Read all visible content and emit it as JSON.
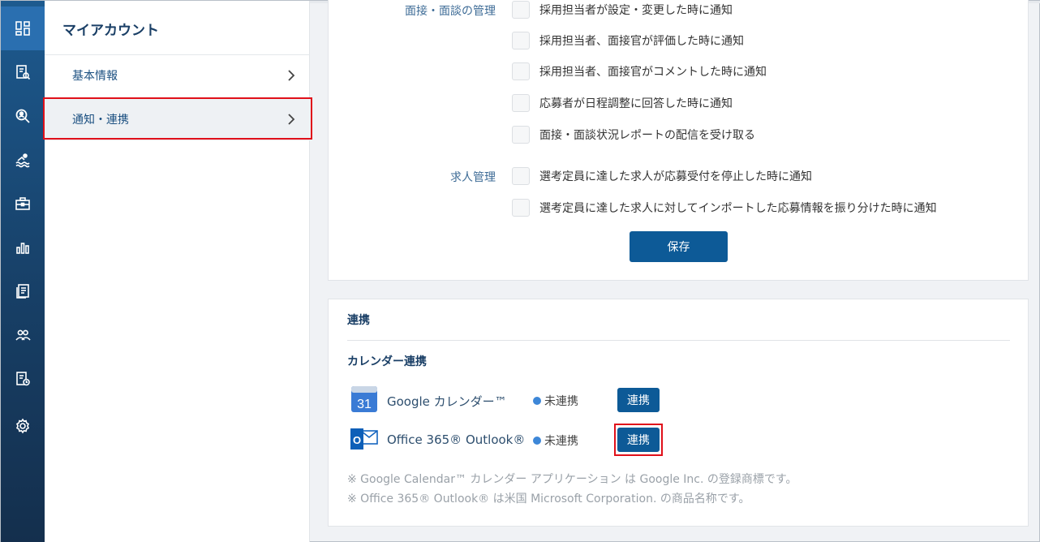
{
  "sidebar": {
    "title": "マイアカウント",
    "items": [
      {
        "label": "基本情報"
      },
      {
        "label": "通知・連携"
      }
    ]
  },
  "rail": {
    "icons": [
      "dashboard-icon",
      "document-search-icon",
      "magnifier-user-icon",
      "swimmer-icon",
      "briefcase-icon",
      "bar-chart-icon",
      "receipt-icon",
      "users-icon",
      "document-clock-icon",
      "settings-gear-icon"
    ]
  },
  "notifications": {
    "interview_label": "面接・面談の管理",
    "interview_items": [
      "採用担当者が設定・変更した時に通知",
      "採用担当者、面接官が評価した時に通知",
      "採用担当者、面接官がコメントした時に通知",
      "応募者が日程調整に回答した時に通知",
      "面接・面談状況レポートの配信を受け取る"
    ],
    "job_label": "求人管理",
    "job_items": [
      "選考定員に達した求人が応募受付を停止した時に通知",
      "選考定員に達した求人に対してインポートした応募情報を振り分けた時に通知"
    ],
    "save_label": "保存"
  },
  "integration": {
    "title": "連携",
    "calendar_title": "カレンダー連携",
    "services": [
      {
        "name": "Google カレンダー™",
        "status": "未連携",
        "button": "連携",
        "icon": "google-calendar-icon",
        "icon_text": "31"
      },
      {
        "name": "Office 365® Outlook®",
        "status": "未連携",
        "button": "連携",
        "icon": "outlook-icon",
        "icon_text": "O"
      }
    ],
    "notes": [
      "※ Google Calendar™ カレンダー アプリケーション は Google Inc. の登録商標です。",
      "※ Office 365® Outlook® は米国 Microsoft Corporation. の商品名称です。"
    ]
  },
  "colors": {
    "accent": "#0d5a97",
    "highlight": "#e0101a",
    "status_dot": "#3d87d8"
  }
}
